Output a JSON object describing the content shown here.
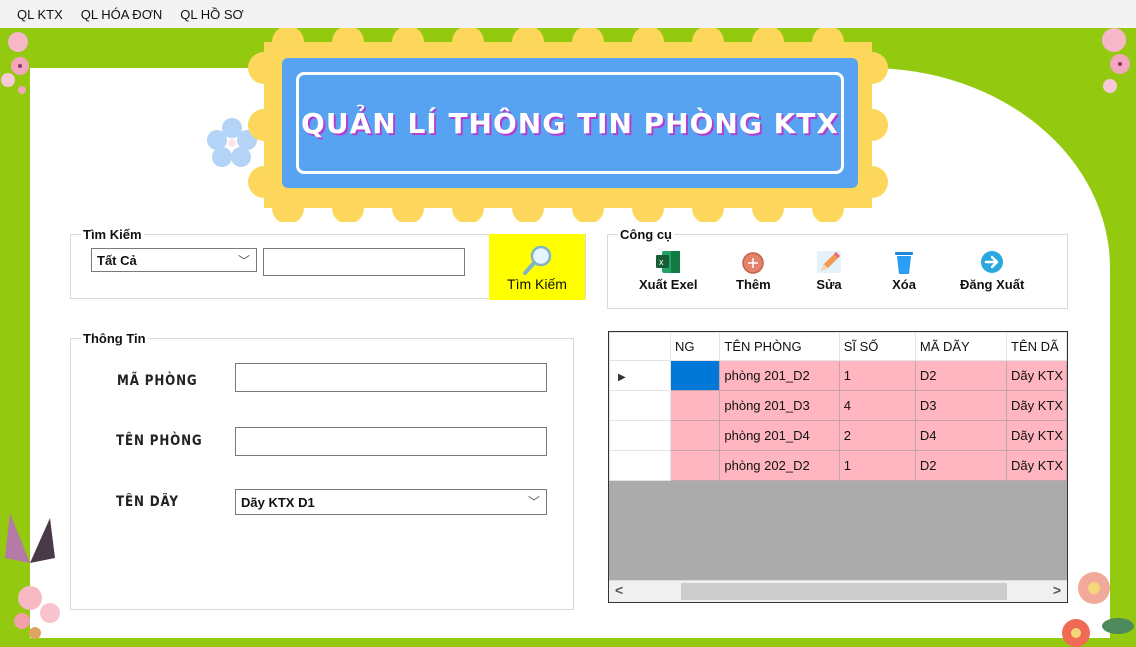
{
  "menu": [
    "QL KTX",
    "QL HÓA ĐƠN",
    "QL HỒ SƠ"
  ],
  "title": "QUẢN LÍ THÔNG TIN PHÒNG KTX",
  "colors": {
    "green": "#93c90e",
    "yellow_scallop": "#fdd75c",
    "title_blue": "#57a3f2",
    "search_button": "#ffff00",
    "row_pink": "#ffb6c1",
    "selected_blue": "#0078d7"
  },
  "search": {
    "legend": "Tìm Kiếm",
    "filter_selected": "Tất Cả",
    "query_value": "",
    "button_label": "Tìm Kiếm",
    "button_icon": "magnifier-icon"
  },
  "tools": {
    "legend": "Công cụ",
    "buttons": [
      {
        "label": "Xuất Exel",
        "icon": "excel-icon"
      },
      {
        "label": "Thêm",
        "icon": "add-circle-icon"
      },
      {
        "label": "Sửa",
        "icon": "pencil-icon"
      },
      {
        "label": "Xóa",
        "icon": "trash-icon"
      },
      {
        "label": "Đăng Xuất",
        "icon": "logout-arrow-icon"
      }
    ]
  },
  "info": {
    "legend": "Thông Tin",
    "ma_phong_label": "MÃ PHÒNG",
    "ma_phong_value": "",
    "ten_phong_label": "TÊN PHÒNG",
    "ten_phong_value": "",
    "ten_day_label": "TÊN DÃY",
    "ten_day_selected": "Dãy KTX D1"
  },
  "grid": {
    "columns": [
      "NG",
      "TÊN PHÒNG",
      "SĨ SỐ",
      "MÃ DÃY",
      "TÊN DÃ"
    ],
    "rows": [
      {
        "c0": "",
        "ten_phong": "phòng 201_D2",
        "si_so": "1",
        "ma_day": "D2",
        "ten_day": "Dãy KTX",
        "current": true
      },
      {
        "c0": "",
        "ten_phong": "phòng 201_D3",
        "si_so": "4",
        "ma_day": "D3",
        "ten_day": "Dãy KTX",
        "current": false
      },
      {
        "c0": "",
        "ten_phong": "phòng 201_D4",
        "si_so": "2",
        "ma_day": "D4",
        "ten_day": "Dãy KTX",
        "current": false
      },
      {
        "c0": "",
        "ten_phong": "phòng 202_D2",
        "si_so": "1",
        "ma_day": "D2",
        "ten_day": "Dãy KTX",
        "current": false
      }
    ],
    "current_row_marker": "▶",
    "scroll_left": "<",
    "scroll_right": ">"
  }
}
